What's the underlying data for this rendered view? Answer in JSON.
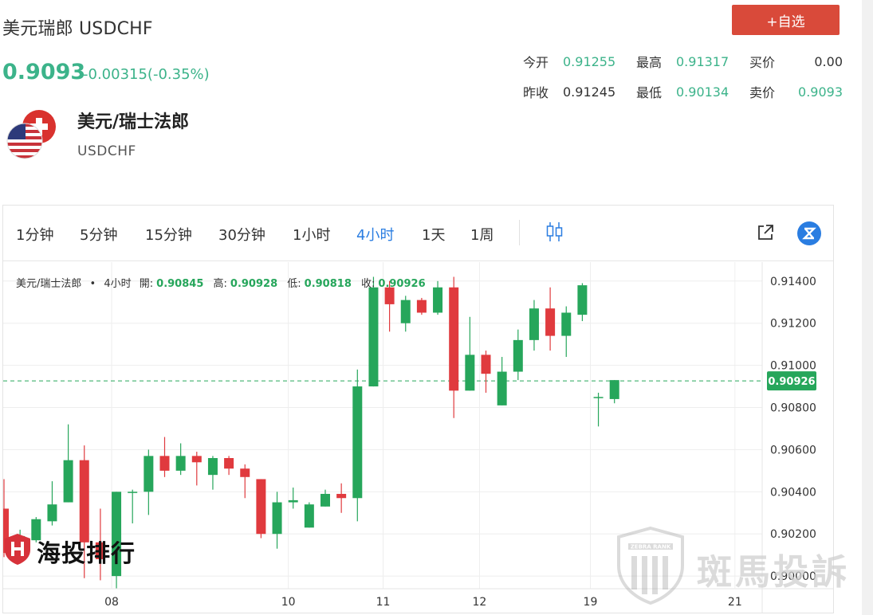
{
  "header": {
    "title": "美元瑞郎 USDCHF",
    "price": "0.9093",
    "change": "-0.00315(-0.35%)",
    "add_watch_label": "+自选"
  },
  "quote": {
    "open_label": "今开",
    "open": "0.91255",
    "high_label": "最高",
    "high": "0.91317",
    "bid_label": "买价",
    "bid": "0.00",
    "prev_close_label": "昨收",
    "prev_close": "0.91245",
    "low_label": "最低",
    "low": "0.90134",
    "ask_label": "卖价",
    "ask": "0.9093"
  },
  "pair": {
    "name": "美元/瑞士法郎",
    "code": "USDCHF"
  },
  "toolbar": {
    "timeframes": [
      "1分钟",
      "5分钟",
      "15分钟",
      "30分钟",
      "1小时",
      "4小时",
      "1天",
      "1周"
    ],
    "active": "4小时"
  },
  "legend": {
    "symbol": "美元/瑞士法郎",
    "dot": "•",
    "interval": "4小时",
    "open_label": "開:",
    "open": "0.90845",
    "high_label": "高:",
    "high": "0.90928",
    "low_label": "低:",
    "low": "0.90818",
    "close_label": "收:",
    "close": "0.90926"
  },
  "watermarks": {
    "left": "海投排行",
    "right": "斑馬投訴",
    "right_badge": "ZEBRA RANK"
  },
  "colors": {
    "up": "#26a65b",
    "down": "#e03a3e",
    "accent": "#2a7de1",
    "brand_red": "#d94a3a",
    "quote_green": "#3cb38a"
  },
  "chart_data": {
    "type": "candlestick",
    "interval": "4小时",
    "y_ticks": [
      0.914,
      0.912,
      0.91,
      0.908,
      0.906,
      0.904,
      0.902,
      0.9
    ],
    "y_tick_labels": [
      "0.91400",
      "0.91200",
      "0.91000",
      "0.90800",
      "0.90600",
      "0.90400",
      "0.90200",
      "0.90000"
    ],
    "ylim": [
      0.8994,
      0.9149
    ],
    "x_labels": [
      "08",
      "10",
      "11",
      "12",
      "19",
      "21"
    ],
    "last_price": 0.90926,
    "last_price_label": "0.90926",
    "grid": true,
    "candles": [
      {
        "x": 0,
        "o": 0.9032,
        "h": 0.9046,
        "l": 0.9009,
        "c": 0.9011
      },
      {
        "x": 1,
        "o": 0.9014,
        "h": 0.9022,
        "l": 0.9006,
        "c": 0.9019
      },
      {
        "x": 2,
        "o": 0.9017,
        "h": 0.9028,
        "l": 0.9016,
        "c": 0.9027
      },
      {
        "x": 3,
        "o": 0.9026,
        "h": 0.9045,
        "l": 0.9024,
        "c": 0.9034
      },
      {
        "x": 4,
        "o": 0.9035,
        "h": 0.9072,
        "l": 0.9035,
        "c": 0.9055
      },
      {
        "x": 5,
        "o": 0.9055,
        "h": 0.9062,
        "l": 0.8999,
        "c": 0.9016
      },
      {
        "x": 6,
        "o": 0.9016,
        "h": 0.9032,
        "l": 0.8998,
        "c": 0.9008
      },
      {
        "x": 7,
        "o": 0.9,
        "h": 0.904,
        "l": 0.8994,
        "c": 0.904
      },
      {
        "x": 8,
        "o": 0.904,
        "h": 0.9041,
        "l": 0.9025,
        "c": 0.904
      },
      {
        "x": 9,
        "o": 0.904,
        "h": 0.906,
        "l": 0.9029,
        "c": 0.9057
      },
      {
        "x": 10,
        "o": 0.9057,
        "h": 0.9066,
        "l": 0.9047,
        "c": 0.905
      },
      {
        "x": 11,
        "o": 0.905,
        "h": 0.9063,
        "l": 0.9048,
        "c": 0.9057
      },
      {
        "x": 12,
        "o": 0.9057,
        "h": 0.9059,
        "l": 0.9043,
        "c": 0.9054
      },
      {
        "x": 13,
        "o": 0.9048,
        "h": 0.9057,
        "l": 0.9041,
        "c": 0.9056
      },
      {
        "x": 14,
        "o": 0.9056,
        "h": 0.9057,
        "l": 0.9048,
        "c": 0.9051
      },
      {
        "x": 15,
        "o": 0.9051,
        "h": 0.9053,
        "l": 0.9037,
        "c": 0.9047
      },
      {
        "x": 16,
        "o": 0.9046,
        "h": 0.9046,
        "l": 0.9018,
        "c": 0.902
      },
      {
        "x": 17,
        "o": 0.902,
        "h": 0.904,
        "l": 0.9013,
        "c": 0.9035
      },
      {
        "x": 18,
        "o": 0.9035,
        "h": 0.9042,
        "l": 0.9032,
        "c": 0.9036
      },
      {
        "x": 19,
        "o": 0.9023,
        "h": 0.9035,
        "l": 0.9023,
        "c": 0.9034
      },
      {
        "x": 20,
        "o": 0.9033,
        "h": 0.9041,
        "l": 0.9033,
        "c": 0.9039
      },
      {
        "x": 21,
        "o": 0.9039,
        "h": 0.9044,
        "l": 0.903,
        "c": 0.9037
      },
      {
        "x": 22,
        "o": 0.9037,
        "h": 0.9098,
        "l": 0.9026,
        "c": 0.909
      },
      {
        "x": 23,
        "o": 0.909,
        "h": 0.9142,
        "l": 0.909,
        "c": 0.9137
      },
      {
        "x": 24,
        "o": 0.9137,
        "h": 0.914,
        "l": 0.9116,
        "c": 0.9129
      },
      {
        "x": 25,
        "o": 0.912,
        "h": 0.9133,
        "l": 0.9116,
        "c": 0.9131
      },
      {
        "x": 26,
        "o": 0.9131,
        "h": 0.9132,
        "l": 0.9124,
        "c": 0.9125
      },
      {
        "x": 27,
        "o": 0.9125,
        "h": 0.914,
        "l": 0.9124,
        "c": 0.9137
      },
      {
        "x": 28,
        "o": 0.9137,
        "h": 0.9142,
        "l": 0.9075,
        "c": 0.9088
      },
      {
        "x": 29,
        "o": 0.9088,
        "h": 0.9123,
        "l": 0.9088,
        "c": 0.9105
      },
      {
        "x": 30,
        "o": 0.9105,
        "h": 0.9107,
        "l": 0.9087,
        "c": 0.9096
      },
      {
        "x": 31,
        "o": 0.9081,
        "h": 0.9104,
        "l": 0.9081,
        "c": 0.9097
      },
      {
        "x": 32,
        "o": 0.9097,
        "h": 0.9117,
        "l": 0.9093,
        "c": 0.9112
      },
      {
        "x": 33,
        "o": 0.9112,
        "h": 0.9131,
        "l": 0.9107,
        "c": 0.9127
      },
      {
        "x": 34,
        "o": 0.9127,
        "h": 0.9137,
        "l": 0.9107,
        "c": 0.9114
      },
      {
        "x": 35,
        "o": 0.9114,
        "h": 0.9128,
        "l": 0.9104,
        "c": 0.9125
      },
      {
        "x": 36,
        "o": 0.9124,
        "h": 0.9139,
        "l": 0.9121,
        "c": 0.9138
      },
      {
        "x": 37,
        "o": 0.9085,
        "h": 0.9087,
        "l": 0.9071,
        "c": 0.9085
      },
      {
        "x": 38,
        "o": 0.9084,
        "h": 0.9093,
        "l": 0.9082,
        "c": 0.9093
      }
    ]
  }
}
